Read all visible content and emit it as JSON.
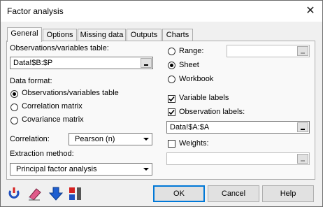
{
  "window": {
    "title": "Factor analysis"
  },
  "tabs": [
    {
      "label": "General"
    },
    {
      "label": "Options"
    },
    {
      "label": "Missing data"
    },
    {
      "label": "Outputs"
    },
    {
      "label": "Charts"
    }
  ],
  "general": {
    "obs_table_label": "Observations/variables table:",
    "obs_table_value": "Data!$B:$P",
    "data_format_label": "Data format:",
    "data_format_options": [
      "Observations/variables table",
      "Correlation matrix",
      "Covariance matrix"
    ],
    "data_format_selected": "Observations/variables table",
    "correlation_label": "Correlation:",
    "correlation_value": "Pearson (n)",
    "extraction_label": "Extraction method:",
    "extraction_value": "Principal factor analysis",
    "output_options": [
      "Range:",
      "Sheet",
      "Workbook"
    ],
    "output_selected": "Sheet",
    "range_value": "",
    "variable_labels_label": "Variable labels",
    "variable_labels_checked": true,
    "observation_labels_label": "Observation labels:",
    "observation_labels_checked": true,
    "observation_labels_value": "Data!$A:$A",
    "weights_label": "Weights:",
    "weights_checked": false,
    "weights_value": ""
  },
  "buttons": {
    "ok": "OK",
    "cancel": "Cancel",
    "help": "Help"
  },
  "icons": [
    "reset-icon",
    "eraser-icon",
    "download-arrow-icon",
    "toggle-options-icon"
  ]
}
